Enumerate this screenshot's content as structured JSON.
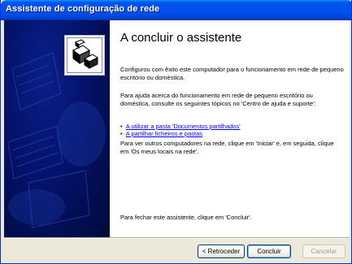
{
  "window": {
    "title": "Assistente de configuração de rede"
  },
  "content": {
    "heading": "A concluir o assistente",
    "paragraph1": "Configurou com êxito este computador para o funcionamento em rede de pequeno escritório ou doméstica.",
    "paragraph2": "Para ajuda acerca do funcionamento em rede de pequeno escritório ou doméstica, consulte os seguintes tópicos no 'Centro de ajuda e suporte':",
    "links": [
      {
        "label": "A utilizar a pasta 'Documentos partilhados'"
      },
      {
        "label": "A partilhar ficheiros e pastas"
      }
    ],
    "paragraph3": "Para ver outros computadores na rede, clique em 'Iniciar' e, em seguida, clique em 'Os meus locais na rede'.",
    "closing": "Para fechar este assistente, clique em 'Concluir'."
  },
  "buttons": {
    "back": "< Retroceder",
    "finish": "Concluir",
    "cancel": "Cancelar"
  },
  "colors": {
    "title_bar": "#0053ee",
    "side_panel": "#04126a",
    "link": "#0000ff"
  },
  "icons": {
    "wizard_logo": "network-computers-icon",
    "bullet": "bullet-icon"
  }
}
